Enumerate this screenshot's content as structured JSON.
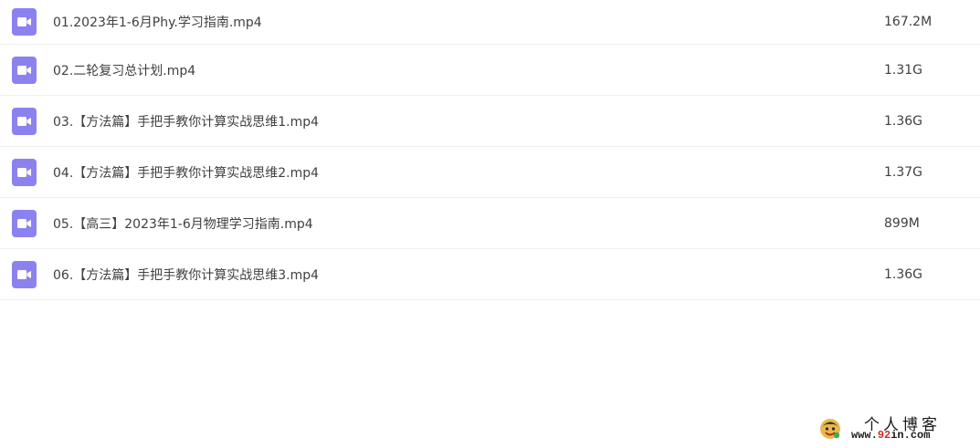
{
  "files": [
    {
      "name": "01.2023年1-6月Phy.学习指南.mp4",
      "size": "167.2M",
      "icon": "video-file-icon"
    },
    {
      "name": "02.二轮复习总计划.mp4",
      "size": "1.31G",
      "icon": "video-file-icon"
    },
    {
      "name": "03.【方法篇】手把手教你计算实战思维1.mp4",
      "size": "1.36G",
      "icon": "video-file-icon"
    },
    {
      "name": "04.【方法篇】手把手教你计算实战思维2.mp4",
      "size": "1.37G",
      "icon": "video-file-icon"
    },
    {
      "name": "05.【高三】2023年1-6月物理学习指南.mp4",
      "size": "899M",
      "icon": "video-file-icon"
    },
    {
      "name": "06.【方法篇】手把手教你计算实战思维3.mp4",
      "size": "1.36G",
      "icon": "video-file-icon"
    }
  ],
  "watermark": {
    "title": "个人博客",
    "url_prefix": "www.",
    "url_accent": "92",
    "url_suffix": "in.com"
  },
  "colors": {
    "icon_bg": "#8b82f0",
    "text": "#404040",
    "divider": "#f0f0f2"
  }
}
